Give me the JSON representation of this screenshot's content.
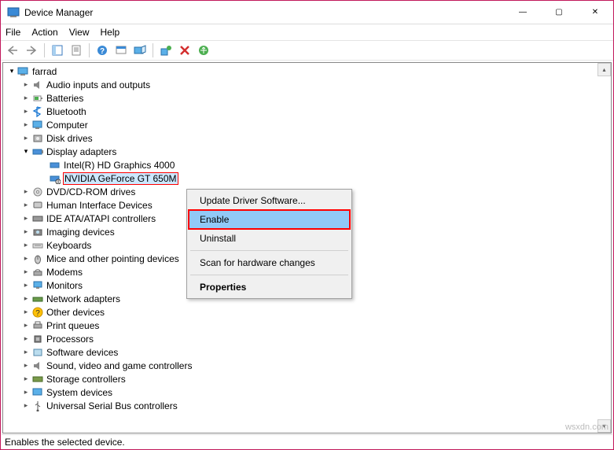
{
  "window": {
    "title": "Device Manager",
    "min": "—",
    "max": "▢",
    "close": "✕"
  },
  "menu": {
    "file": "File",
    "action": "Action",
    "view": "View",
    "help": "Help"
  },
  "tree": {
    "root": "farrad",
    "items": [
      "Audio inputs and outputs",
      "Batteries",
      "Bluetooth",
      "Computer",
      "Disk drives",
      "Display adapters",
      "Intel(R) HD Graphics 4000",
      "NVIDIA GeForce GT 650M",
      "DVD/CD-ROM drives",
      "Human Interface Devices",
      "IDE ATA/ATAPI controllers",
      "Imaging devices",
      "Keyboards",
      "Mice and other pointing devices",
      "Modems",
      "Monitors",
      "Network adapters",
      "Other devices",
      "Print queues",
      "Processors",
      "Software devices",
      "Sound, video and game controllers",
      "Storage controllers",
      "System devices",
      "Universal Serial Bus controllers"
    ]
  },
  "contextMenu": {
    "updateDriver": "Update Driver Software...",
    "enable": "Enable",
    "uninstall": "Uninstall",
    "scan": "Scan for hardware changes",
    "properties": "Properties"
  },
  "status": "Enables the selected device.",
  "watermark": "wsxdn.com"
}
